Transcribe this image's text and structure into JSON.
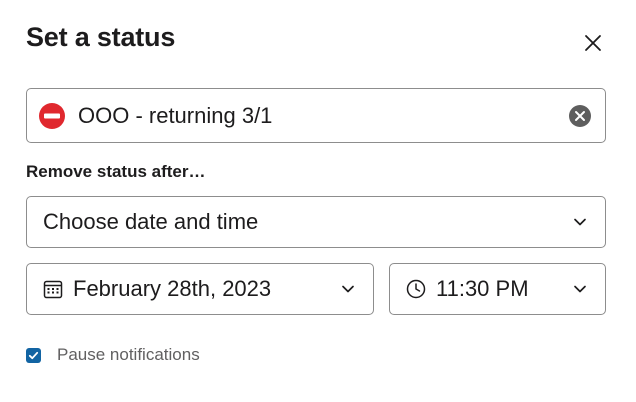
{
  "dialog": {
    "title": "Set a status",
    "close_icon": "close-icon"
  },
  "status": {
    "emoji": "no-entry-icon",
    "text": "OOO - returning 3/1",
    "clear_icon": "clear-circle-icon"
  },
  "expiry": {
    "label": "Remove status after…",
    "duration_value": "Choose date and time",
    "date_value": "February 28th, 2023",
    "time_value": "11:30 PM"
  },
  "notifications": {
    "pause_label": "Pause notifications",
    "pause_checked": true
  },
  "colors": {
    "accent": "#1264a3",
    "emoji_red": "#e0282e",
    "border": "#8d8d8d"
  }
}
